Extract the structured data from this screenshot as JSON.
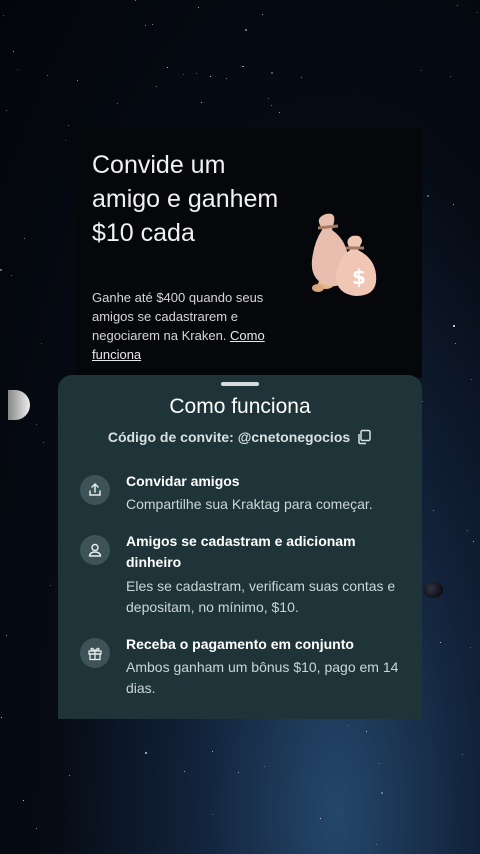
{
  "promo": {
    "title": "Convide um amigo e ganhem $10 cada",
    "description": "Ganhe até $400 quando seus amigos se cadastrarem e negociarem na Kraken.",
    "link": "Como funciona"
  },
  "sheet": {
    "title": "Como funciona",
    "invite_code": "Código de convite: @cnetonegocios",
    "steps": [
      {
        "icon": "share-icon",
        "title": "Convidar amigos",
        "description": "Compartilhe sua Kraktag para começar."
      },
      {
        "icon": "user-icon",
        "title": "Amigos se cadastram e adicionam dinheiro",
        "description": "Eles se cadastram, verificam suas contas e depositam, no mínimo, $10."
      },
      {
        "icon": "gift-icon",
        "title": "Receba o pagamento em conjunto",
        "description": "Ambos ganham um bônus $10, pago em 14 dias."
      }
    ]
  },
  "colors": {
    "sheet_background": "#1e3438",
    "icon_circle": "#3d5357",
    "promo_background": "#06070b"
  }
}
